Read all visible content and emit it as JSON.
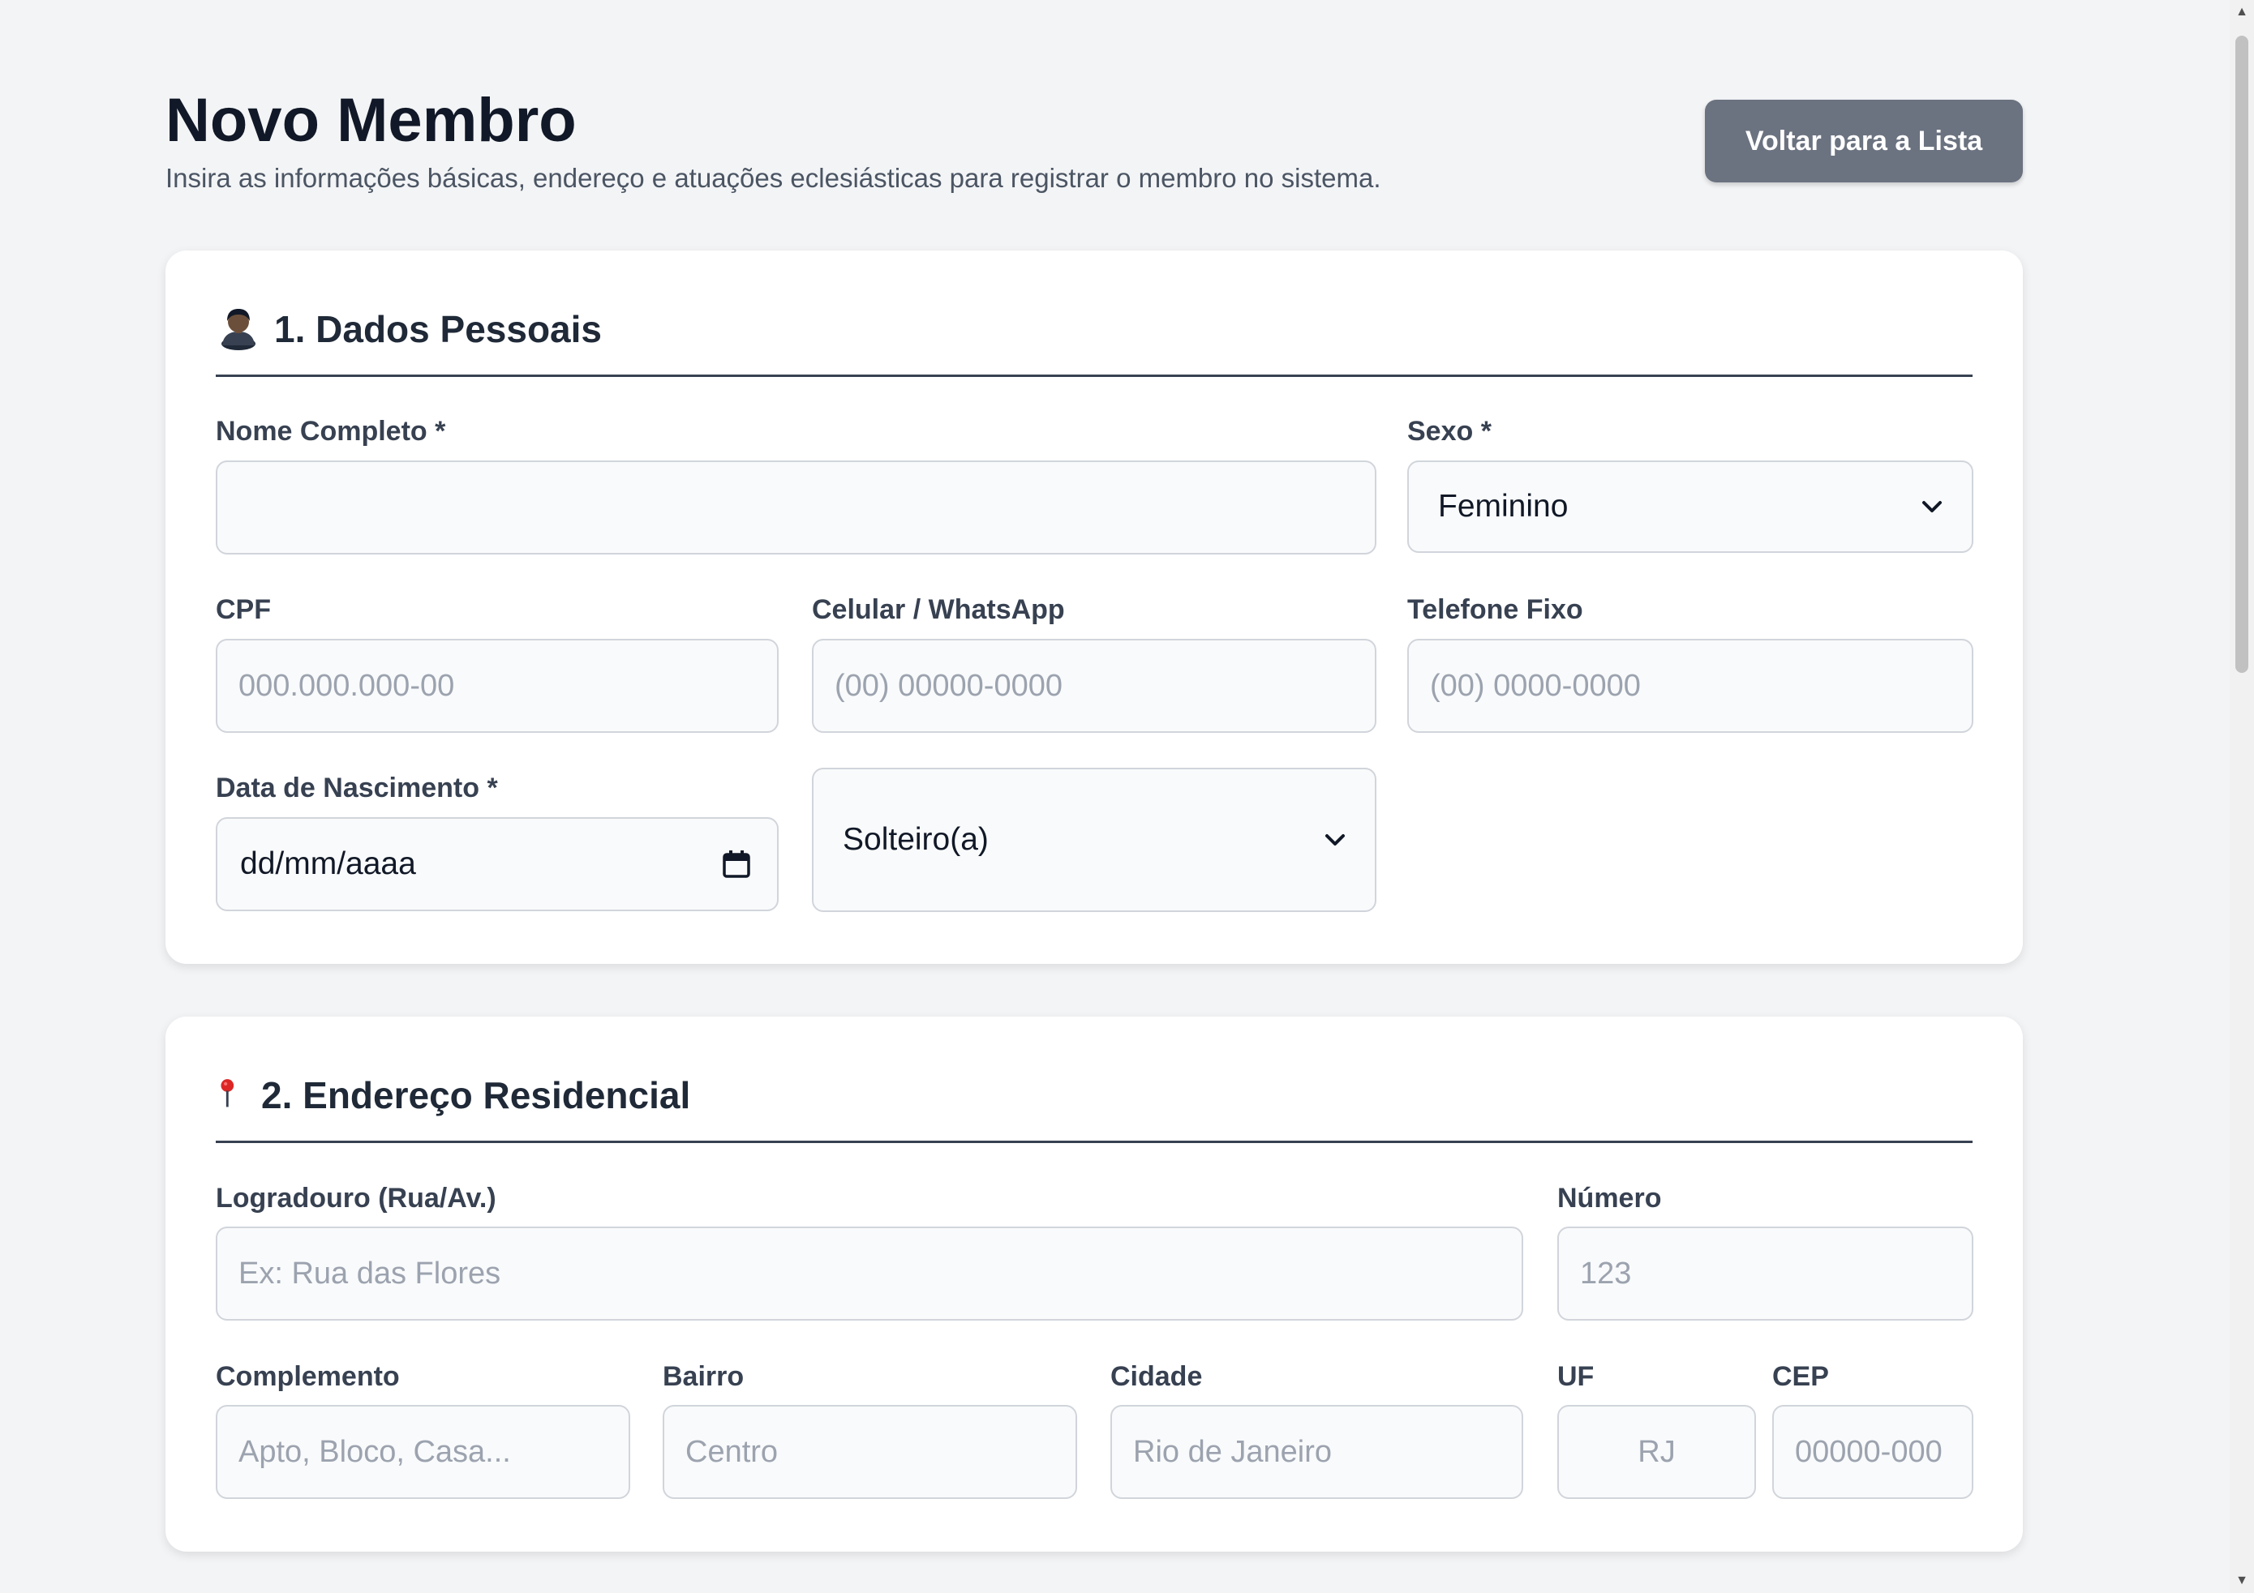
{
  "header": {
    "title": "Novo Membro",
    "subtitle": "Insira as informações básicas, endereço e atuações eclesiásticas para registrar o membro no sistema.",
    "back_button_label": "Voltar para a Lista"
  },
  "personal_section": {
    "icon": "person-icon",
    "title": "1. Dados Pessoais",
    "full_name": {
      "label": "Nome Completo *",
      "value": "",
      "placeholder": ""
    },
    "sex": {
      "label": "Sexo *",
      "selected": "Feminino"
    },
    "cpf": {
      "label": "CPF",
      "value": "",
      "placeholder": "000.000.000-00"
    },
    "mobile": {
      "label": "Celular / WhatsApp",
      "value": "",
      "placeholder": "(00) 00000-0000"
    },
    "landline": {
      "label": "Telefone Fixo",
      "value": "",
      "placeholder": "(00) 0000-0000"
    },
    "birth_date": {
      "label": "Data de Nascimento *",
      "display": "dd/mm/aaaa"
    },
    "marital_status": {
      "selected": "Solteiro(a)"
    }
  },
  "address_section": {
    "icon": "location-pin-icon",
    "title": "2. Endereço Residencial",
    "street": {
      "label": "Logradouro (Rua/Av.)",
      "value": "",
      "placeholder": "Ex: Rua das Flores"
    },
    "number": {
      "label": "Número",
      "value": "",
      "placeholder": "123"
    },
    "complement": {
      "label": "Complemento",
      "value": "",
      "placeholder": "Apto, Bloco, Casa..."
    },
    "neighborhood": {
      "label": "Bairro",
      "value": "",
      "placeholder": "Centro"
    },
    "city": {
      "label": "Cidade",
      "value": "",
      "placeholder": "Rio de Janeiro"
    },
    "state": {
      "label": "UF",
      "value": "",
      "placeholder": "RJ"
    },
    "zip": {
      "label": "CEP",
      "value": "",
      "placeholder": "00000-000"
    }
  },
  "colors": {
    "page_background": "#f3f4f6",
    "card_background": "#ffffff",
    "button_background": "#6b7280",
    "input_background": "#f9fafb",
    "input_border": "#d1d5db",
    "title_color": "#111827"
  }
}
